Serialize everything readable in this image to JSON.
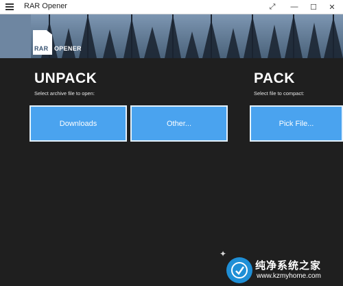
{
  "window": {
    "title": "RAR Opener",
    "controls": {
      "expand": "⤢",
      "minimize": "—",
      "maximize": "☐",
      "close": "✕"
    }
  },
  "header": {
    "logo": {
      "part1": "RAR",
      "part2": "OPENER"
    }
  },
  "unpack": {
    "title": "UNPACK",
    "subtitle": "Select archive file to open:",
    "buttons": [
      "Downloads",
      "Other..."
    ]
  },
  "pack": {
    "title": "PACK",
    "subtitle": "Select file to compact:",
    "button": "Pick File..."
  },
  "watermark": {
    "title": "纯净系统之家",
    "url": "www.kzmyhome.com"
  },
  "colors": {
    "background": "#1f1f1f",
    "tile": "#4aa3ef",
    "titlebar": "#ffffff"
  }
}
